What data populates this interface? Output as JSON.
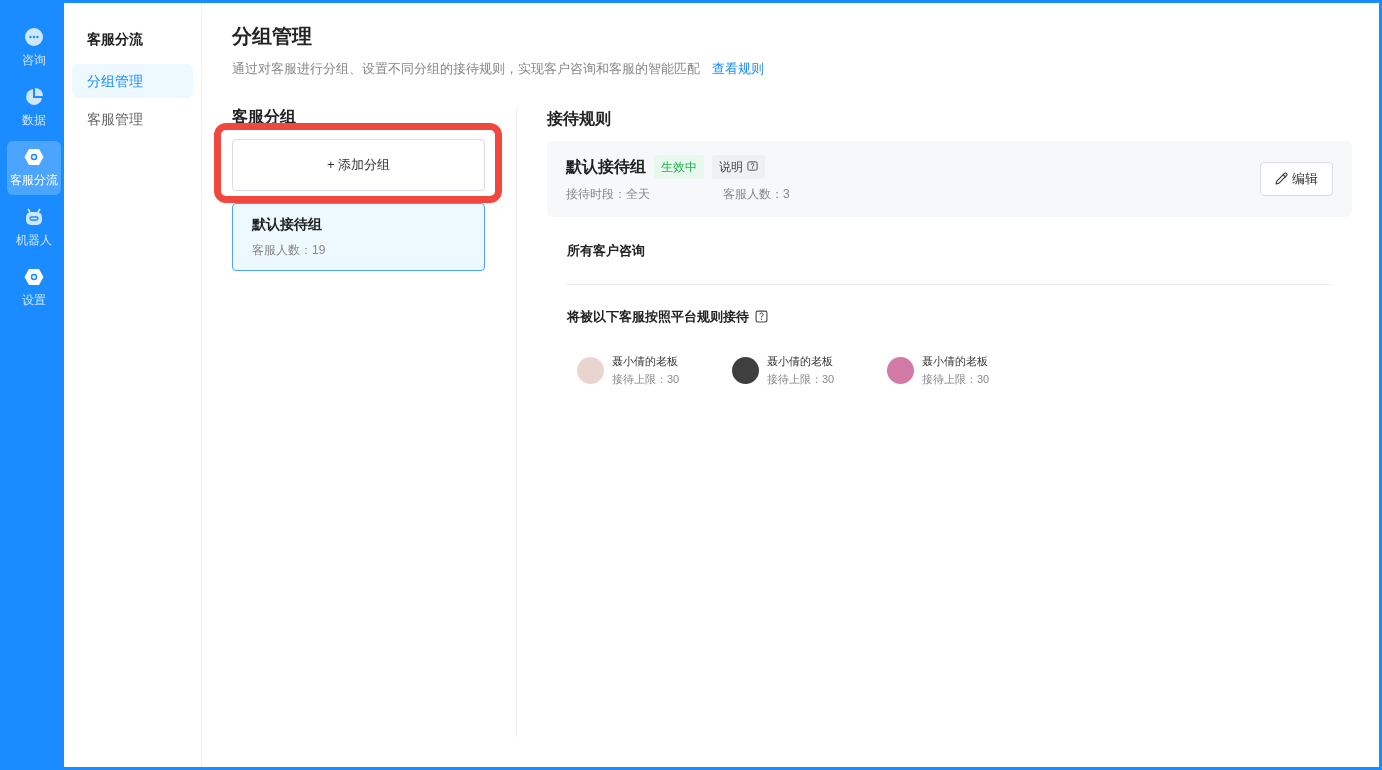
{
  "rail": [
    {
      "label": "咨询",
      "kind": "chat",
      "selected": false
    },
    {
      "label": "数据",
      "kind": "pie",
      "selected": false
    },
    {
      "label": "客服分流",
      "kind": "hex",
      "selected": true
    },
    {
      "label": "机器人",
      "kind": "robot",
      "selected": false
    },
    {
      "label": "设置",
      "kind": "hex",
      "selected": false
    }
  ],
  "subnav": {
    "title": "客服分流",
    "items": [
      {
        "label": "分组管理",
        "selected": true
      },
      {
        "label": "客服管理",
        "selected": false
      }
    ]
  },
  "page": {
    "title": "分组管理",
    "description": "通过对客服进行分组、设置不同分组的接待规则，实现客户咨询和客服的智能匹配",
    "link": "查看规则"
  },
  "groups_panel": {
    "title": "客服分组",
    "add_button": "+ 添加分组",
    "highlighted": true,
    "groups": [
      {
        "name": "默认接待组",
        "count": "客服人数：19",
        "selected": true
      }
    ]
  },
  "rules_panel": {
    "title": "接待规则",
    "group_name": "默认接待组",
    "status": "生效中",
    "help": "说明",
    "hours": "接待时段：全天",
    "count": "客服人数：3",
    "edit_button": "编辑",
    "scope": "所有客户咨询",
    "agents_title": "将被以下客服按照平台规则接待",
    "agents": [
      {
        "name": "聂小倩的老板",
        "limit": "接待上限：30",
        "color": "#e9d5cf"
      },
      {
        "name": "聂小倩的老板",
        "limit": "接待上限：30",
        "color": "#3f3f3f"
      },
      {
        "name": "聂小倩的老板",
        "limit": "接待上限：30",
        "color": "#d17aa6"
      }
    ]
  }
}
